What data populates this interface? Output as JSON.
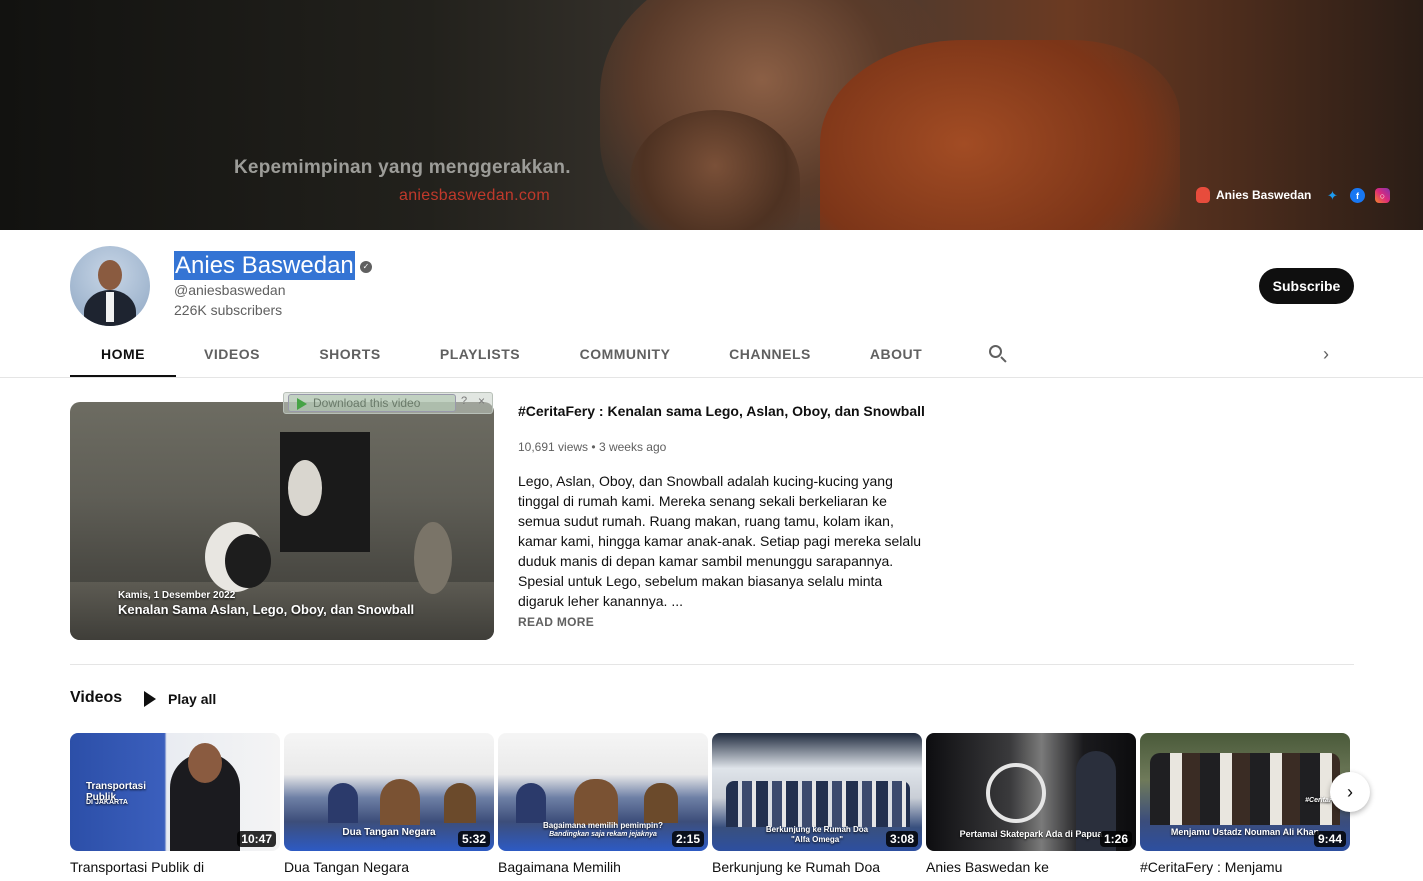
{
  "banner": {
    "tagline": "Kepemimpinan yang menggerakkan.",
    "site": "aniesbaswedan.com",
    "brand": "Anies Baswedan",
    "socials": [
      "twitter-icon",
      "facebook-icon",
      "instagram-icon"
    ]
  },
  "channel": {
    "name": "Anies Baswedan",
    "handle": "@aniesbaswedan",
    "subscribers": "226K subscribers",
    "subscribe_label": "Subscribe"
  },
  "tabs": [
    {
      "label": "HOME",
      "active": true
    },
    {
      "label": "VIDEOS"
    },
    {
      "label": "SHORTS"
    },
    {
      "label": "PLAYLISTS"
    },
    {
      "label": "COMMUNITY"
    },
    {
      "label": "CHANNELS"
    },
    {
      "label": "ABOUT"
    }
  ],
  "download_overlay": {
    "label": "Download this video",
    "help": "?",
    "close": "×"
  },
  "featured": {
    "thumb_date": "Kamis, 1 Desember 2022",
    "thumb_title": "Kenalan Sama Aslan, Lego, Oboy, dan Snowball",
    "title": "#CeritaFery : Kenalan sama Lego, Aslan, Oboy, dan Snowball",
    "views": "10,691 views",
    "ago": "3 weeks ago",
    "description": "Lego, Aslan, Oboy, dan Snowball adalah kucing-kucing yang tinggal di rumah kami. Mereka senang sekali berkeliaran ke semua sudut rumah. Ruang makan, ruang tamu, kolam ikan, kamar kami, hingga kamar anak-anak. Setiap pagi mereka selalu duduk manis di depan kamar sambil menunggu sarapannya. Spesial untuk Lego, sebelum makan biasanya selalu minta digaruk leher kanannya. ...",
    "read_more": "READ MORE"
  },
  "videos_shelf": {
    "title": "Videos",
    "play_all": "Play all",
    "items": [
      {
        "title": "Transportasi Publik di",
        "duration": "10:47",
        "caption": "Transportasi Publik",
        "caption2": "DI JAKARTA"
      },
      {
        "title": "Dua Tangan Negara",
        "duration": "5:32",
        "caption": "Dua Tangan Negara"
      },
      {
        "title": "Bagaimana Memilih",
        "duration": "2:15",
        "caption": "Bagaimana memilih pemimpin?",
        "caption2": "Bandingkan saja rekam jejaknya"
      },
      {
        "title": "Berkunjung ke Rumah Doa",
        "duration": "3:08",
        "caption": "Berkunjung ke Rumah Doa",
        "caption2": "\"Alfa Omega\""
      },
      {
        "title": "Anies Baswedan ke",
        "duration": "1:26",
        "caption": "Pertamai Skatepark Ada di Papua"
      },
      {
        "title": "#CeritaFery : Menjamu",
        "duration": "9:44",
        "caption": "Menjamu Ustadz Nouman Ali Khan",
        "caption2": "#CeritaFery:"
      }
    ]
  }
}
